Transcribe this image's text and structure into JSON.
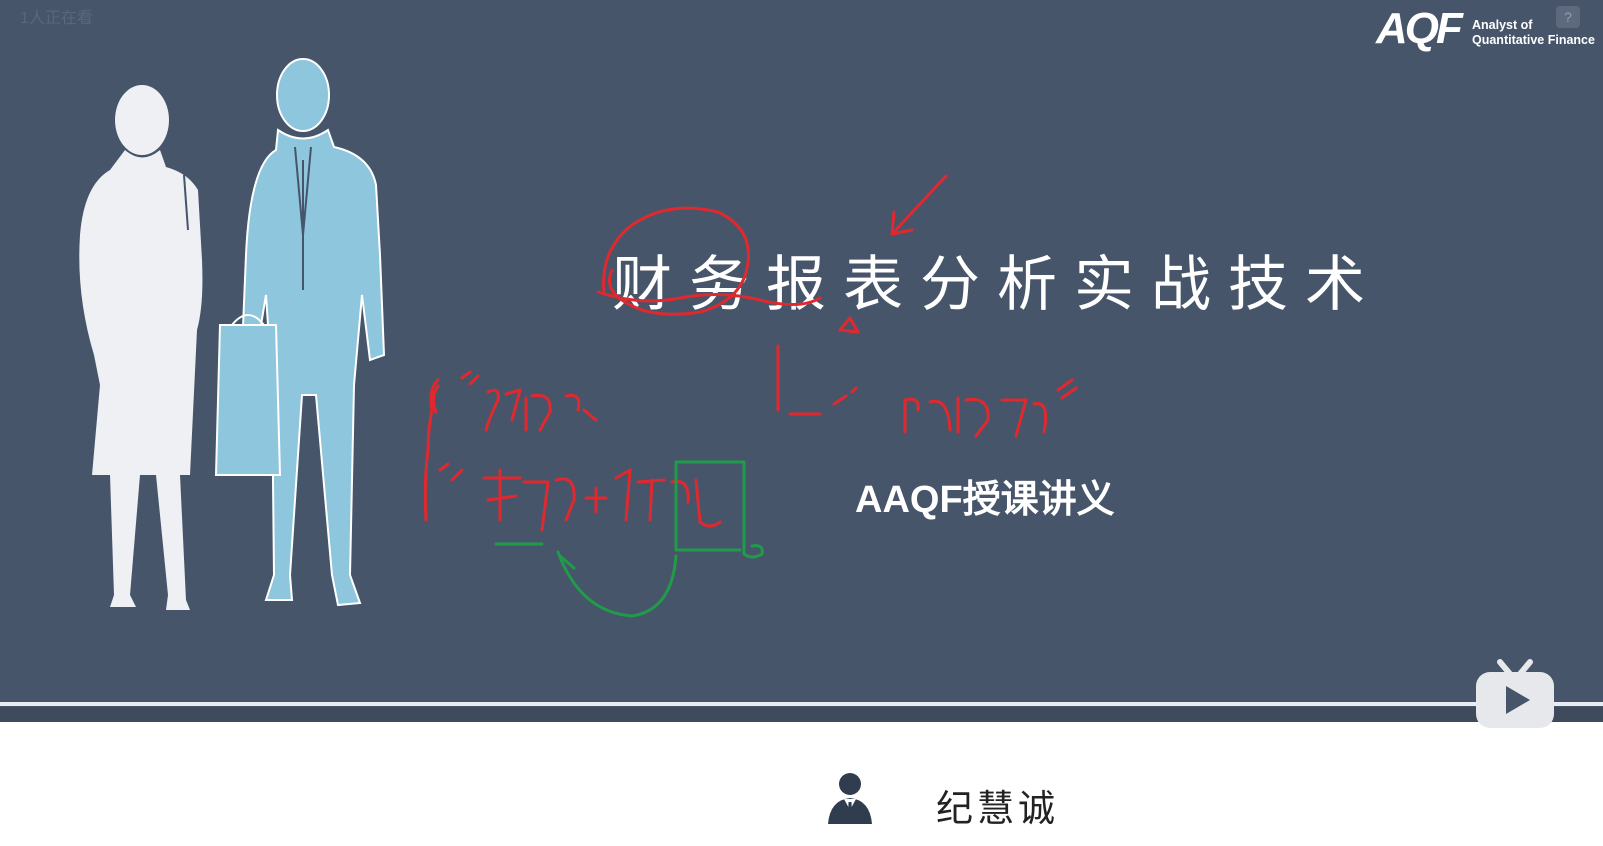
{
  "viewer_count": "1人正在看",
  "logo": {
    "mark": "AQF",
    "line1": "Analyst of",
    "line2": "Quantitative Finance"
  },
  "help_label": "?",
  "slide": {
    "title": "财务报表分析实战技术",
    "subtitle": "AAQF授课讲义"
  },
  "author": {
    "name": "纪慧诚"
  },
  "colors": {
    "slide_bg": "#47556a",
    "silhouette_woman": "#eef0f3",
    "silhouette_man": "#8ec6dd",
    "ink_red": "#e0292e",
    "ink_green": "#1f9b4a"
  },
  "icons": {
    "author": "person-icon",
    "player": "bilibili-play-icon",
    "help": "help-icon"
  }
}
